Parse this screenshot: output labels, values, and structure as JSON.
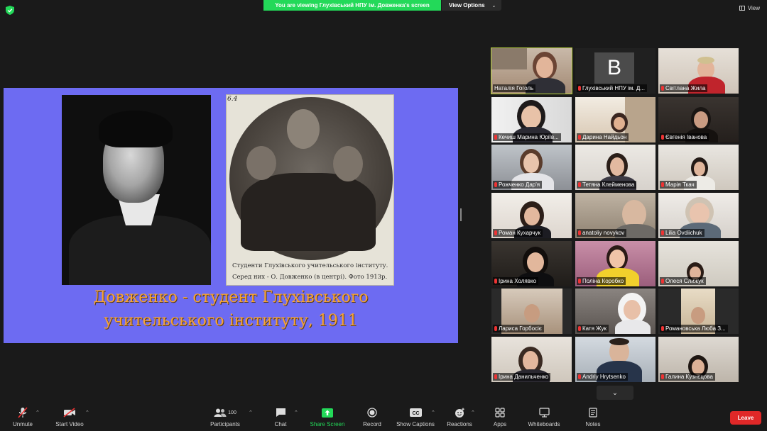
{
  "banner": {
    "text": "You are viewing Глухівський НПУ ім. Довженка's screen"
  },
  "view_options": {
    "label": "View Options"
  },
  "view_button": {
    "label": "View"
  },
  "slide": {
    "photo_number": "6.4",
    "caption_line1": "Студенти Глухівського учительського інституту.",
    "caption_line2": "Серед них - О. Довженко (в центрі). Фото 1913р.",
    "title_line1": "Довженко - студент Глухівського",
    "title_line2": "учительського інституту, 1911",
    "background": "#6d6bf2",
    "title_color": "#f6a335"
  },
  "participants": [
    {
      "name": "Наталія Гоголь",
      "muted": false,
      "active": true
    },
    {
      "name": "Глухівський НПУ ім. Д...",
      "muted": true,
      "avatar_letter": "B"
    },
    {
      "name": "Світлана Жила",
      "muted": true
    },
    {
      "name": "Кечиш Марина Юріїв...",
      "muted": true
    },
    {
      "name": "Дарина Найдьон",
      "muted": true
    },
    {
      "name": "Євгенія Іванова",
      "muted": true
    },
    {
      "name": "Рожченко Дар'я",
      "muted": true
    },
    {
      "name": "Тетяна Клейменова",
      "muted": true
    },
    {
      "name": "Марія Ткач",
      "muted": true
    },
    {
      "name": "Роман Кухарчук",
      "muted": true
    },
    {
      "name": "anatoliy novykov",
      "muted": true
    },
    {
      "name": "Lilia Ovdiichuk",
      "muted": true
    },
    {
      "name": "Ірина Холявко",
      "muted": true
    },
    {
      "name": "Поліна Коробко",
      "muted": true
    },
    {
      "name": "Олеся Слижук",
      "muted": true
    },
    {
      "name": "Лариса Горбосіє",
      "muted": true
    },
    {
      "name": "Катя Жук",
      "muted": true
    },
    {
      "name": "Романовська Люба З...",
      "muted": true
    },
    {
      "name": "Ірина Данильченко",
      "muted": true
    },
    {
      "name": "Andriy Hrytsenko",
      "muted": true
    },
    {
      "name": "Галина Кузнєцова",
      "muted": true
    }
  ],
  "toolbar": {
    "unmute": "Unmute",
    "start_video": "Start Video",
    "participants": "Participants",
    "participants_count": "100",
    "chat": "Chat",
    "share_screen": "Share Screen",
    "record": "Record",
    "show_captions": "Show Captions",
    "reactions": "Reactions",
    "apps": "Apps",
    "whiteboards": "Whiteboards",
    "notes": "Notes",
    "leave": "Leave"
  },
  "colors": {
    "share_green": "#23d959",
    "leave_red": "#e02828",
    "active_speaker": "#b8d43b"
  }
}
